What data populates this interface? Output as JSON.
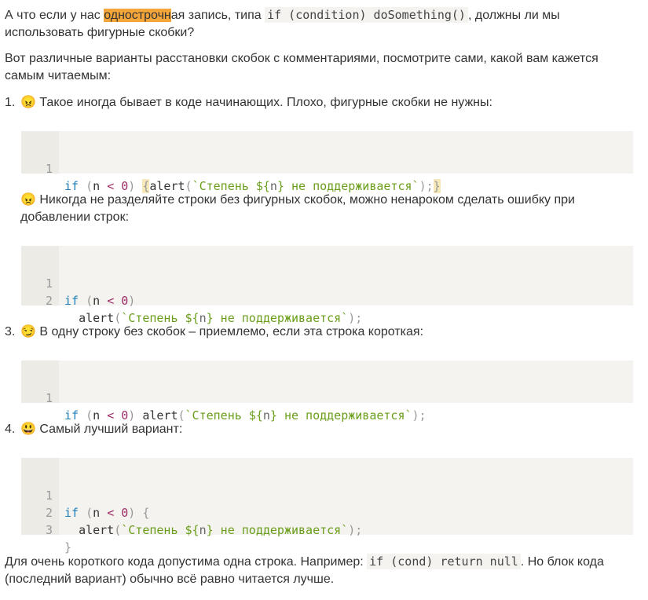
{
  "intro": {
    "before": "А что если у нас ",
    "highlight": "однострочн",
    "after_hl": "ая запись, типа ",
    "code": "if (condition) doSomething()",
    "after_code": ", должны ли мы использовать фигурные скобки?"
  },
  "para2": "Вот различные варианты расстановки скобок с комментариями, посмотрите сами, какой вам кажется самым читаемым:",
  "items": [
    {
      "num": "1.",
      "text": "😠 Такое иногда бывает в коде начинающих. Плохо, фигурные скобки не нужны:"
    },
    {
      "num": "2.",
      "text": "😠 Никогда не разделяйте строки без фигурных скобок, можно ненароком сделать ошибку при добавлении строк:"
    },
    {
      "num": "3.",
      "text": "😏 В одну строку без скобок – приемлемо, если эта строка короткая:"
    },
    {
      "num": "4.",
      "text": "😃 Самый лучший вариант:"
    }
  ],
  "code": {
    "kw_if": "if",
    "n": "n",
    "lt": "<",
    "zero": "0",
    "alert": "alert",
    "str_a": "`Степень ${",
    "str_n": "n",
    "str_b": "} не поддерживается`",
    "lp": "(",
    "rp": ")",
    "semi": ";",
    "lbrace": "{",
    "rbrace": "}",
    "ln1": "1",
    "ln2": "2",
    "ln3": "3"
  },
  "outro": {
    "before": "Для очень короткого кода допустима одна строка. Например: ",
    "code": "if (cond) return null",
    "after": ". Но блок кода (последний вариант) обычно всё равно читается лучше."
  }
}
